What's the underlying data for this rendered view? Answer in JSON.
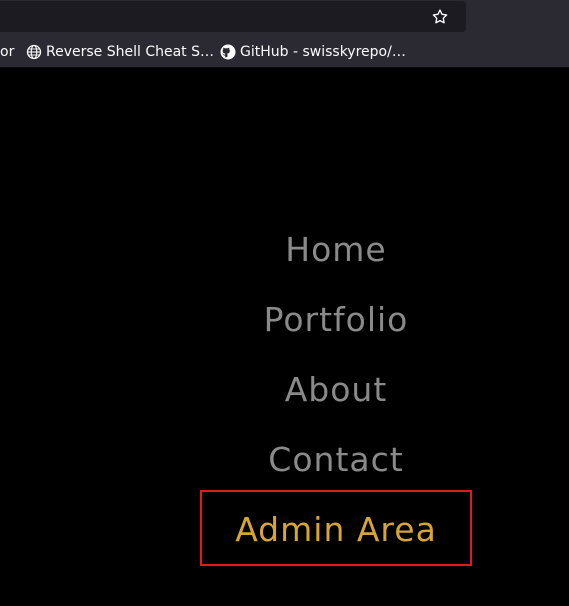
{
  "browser": {
    "bookmarks": [
      {
        "label": "or",
        "icon": "none"
      },
      {
        "label": "Reverse Shell Cheat S…",
        "icon": "globe-icon"
      },
      {
        "label": "GitHub - swisskyrepo/…",
        "icon": "github-icon"
      }
    ]
  },
  "nav": {
    "items": [
      {
        "label": "Home"
      },
      {
        "label": "Portfolio"
      },
      {
        "label": "About"
      },
      {
        "label": "Contact"
      },
      {
        "label": "Admin Area"
      }
    ],
    "highlight_color": "#d6a534",
    "outline_color": "#e01a1a"
  }
}
